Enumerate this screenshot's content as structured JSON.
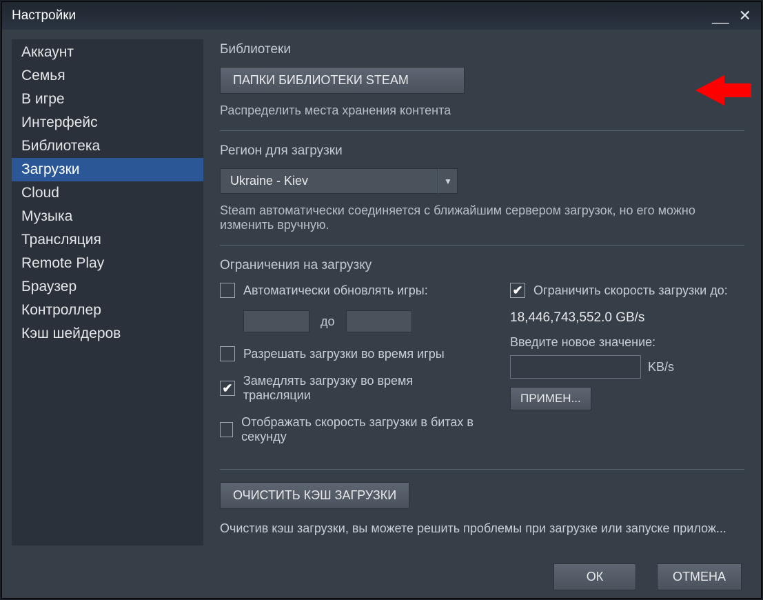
{
  "title": "Настройки",
  "sidebar": {
    "items": [
      {
        "label": "Аккаунт"
      },
      {
        "label": "Семья"
      },
      {
        "label": "В игре"
      },
      {
        "label": "Интерфейс"
      },
      {
        "label": "Библиотека"
      },
      {
        "label": "Загрузки"
      },
      {
        "label": "Cloud"
      },
      {
        "label": "Музыка"
      },
      {
        "label": "Трансляция"
      },
      {
        "label": "Remote Play"
      },
      {
        "label": "Браузер"
      },
      {
        "label": "Контроллер"
      },
      {
        "label": "Кэш шейдеров"
      }
    ],
    "active_index": 5
  },
  "libraries": {
    "heading": "Библиотеки",
    "button": "ПАПКИ БИБЛИОТЕКИ STEAM",
    "desc": "Распределить места хранения контента"
  },
  "region": {
    "heading": "Регион для загрузки",
    "selected": "Ukraine - Kiev",
    "desc": "Steam автоматически соединяется с ближайшим сервером загрузок, но его можно изменить вручную."
  },
  "limits": {
    "heading": "Ограничения на загрузку",
    "auto_update": "Автоматически обновлять игры:",
    "time_sep": "до",
    "allow_during_game": "Разрешать загрузки во время игры",
    "throttle_stream": "Замедлять загрузку во время трансляции",
    "display_bits": "Отображать скорость загрузки в битах в секунду",
    "limit_speed": "Ограничить скорость загрузки до:",
    "speed_value": "18,446,743,552.0 GB/s",
    "enter_new": "Введите новое значение:",
    "unit": "KB/s",
    "apply": "ПРИМЕН..."
  },
  "clear": {
    "button": "ОЧИСТИТЬ КЭШ ЗАГРУЗКИ",
    "desc": "Очистив кэш загрузки, вы можете решить проблемы при загрузке или запуске прилож..."
  },
  "footer": {
    "ok": "ОК",
    "cancel": "ОТМЕНА"
  },
  "colors": {
    "accent": "#2b5797",
    "arrow": "#ff0000"
  }
}
